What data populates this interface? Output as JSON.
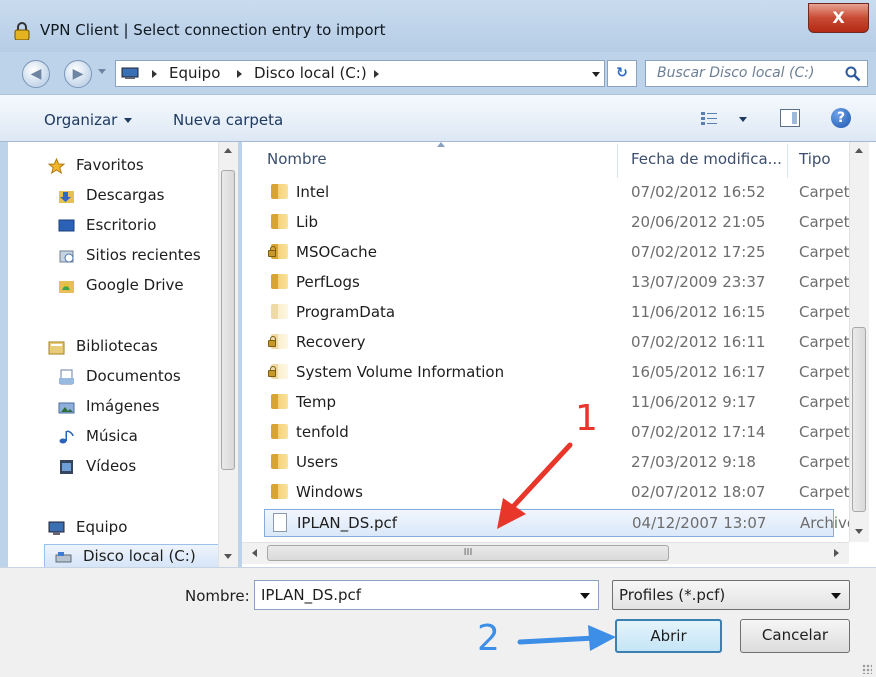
{
  "window": {
    "title": "VPN Client  |  Select connection entry to import",
    "close_glyph": "X"
  },
  "address_bar": {
    "crumbs": [
      "Equipo",
      "Disco local (C:)"
    ],
    "search_placeholder": "Buscar Disco local (C:)"
  },
  "toolbar": {
    "organize": "Organizar",
    "new_folder": "Nueva carpeta"
  },
  "nav": {
    "favorites": "Favoritos",
    "downloads": "Descargas",
    "desktop": "Escritorio",
    "recent": "Sitios recientes",
    "gdrive": "Google Drive",
    "libraries": "Bibliotecas",
    "documents": "Documentos",
    "images": "Imágenes",
    "music": "Música",
    "videos": "Vídeos",
    "computer": "Equipo",
    "local_disk": "Disco local (C:)"
  },
  "columns": {
    "name": "Nombre",
    "date": "Fecha de modifica...",
    "type": "Tipo"
  },
  "files": [
    {
      "name": "Intel",
      "date": "07/02/2012 16:52",
      "type": "Carpeta"
    },
    {
      "name": "Lib",
      "date": "20/06/2012 21:05",
      "type": "Carpeta"
    },
    {
      "name": "MSOCache",
      "date": "07/02/2012 17:25",
      "type": "Carpeta"
    },
    {
      "name": "PerfLogs",
      "date": "13/07/2009 23:37",
      "type": "Carpeta"
    },
    {
      "name": "ProgramData",
      "date": "11/06/2012 16:15",
      "type": "Carpeta"
    },
    {
      "name": "Recovery",
      "date": "07/02/2012 16:11",
      "type": "Carpeta"
    },
    {
      "name": "System Volume Information",
      "date": "16/05/2012 16:17",
      "type": "Carpeta"
    },
    {
      "name": "Temp",
      "date": "11/06/2012 9:17",
      "type": "Carpeta"
    },
    {
      "name": "tenfold",
      "date": "07/02/2012 17:14",
      "type": "Carpeta"
    },
    {
      "name": "Users",
      "date": "27/03/2012 9:18",
      "type": "Carpeta"
    },
    {
      "name": "Windows",
      "date": "02/07/2012 18:07",
      "type": "Carpeta"
    },
    {
      "name": "IPLAN_DS.pcf",
      "date": "04/12/2007 13:07",
      "type": "Archivo"
    }
  ],
  "hscroll_glyph": "III",
  "bottom": {
    "name_label": "Nombre:",
    "name_value": "IPLAN_DS.pcf",
    "filter_value": "Profiles (*.pcf)",
    "open_label": "Abrir",
    "cancel_label": "Cancelar"
  },
  "annotations": {
    "step1": "1",
    "step2": "2",
    "color_red": "#e8372a",
    "color_blue": "#3d8ee6"
  }
}
